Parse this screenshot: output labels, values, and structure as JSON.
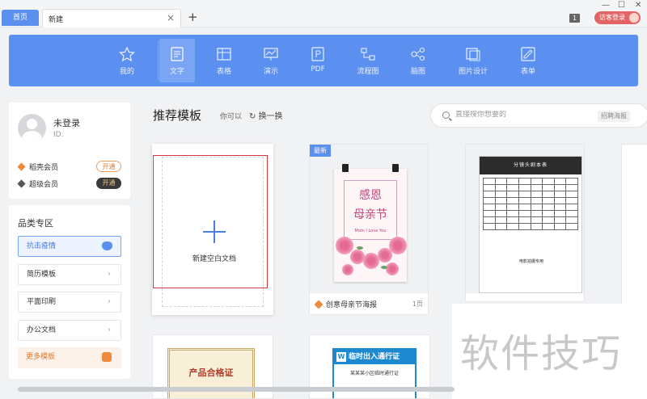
{
  "tabs": {
    "home": "首页",
    "new": "新建",
    "close": "×",
    "add": "+"
  },
  "window": {
    "badge": "1",
    "minimize": "—",
    "maximize": "☐",
    "close": "✕"
  },
  "account": {
    "guest_login": "访客登录"
  },
  "toolbar": {
    "items": [
      {
        "label": "我的",
        "icon": "star-icon"
      },
      {
        "label": "文字",
        "icon": "document-icon",
        "active": true
      },
      {
        "label": "表格",
        "icon": "table-icon"
      },
      {
        "label": "演示",
        "icon": "presentation-icon"
      },
      {
        "label": "PDF",
        "icon": "pdf-icon"
      },
      {
        "label": "流程图",
        "icon": "flowchart-icon"
      },
      {
        "label": "脑图",
        "icon": "mindmap-icon"
      },
      {
        "label": "图片设计",
        "icon": "image-design-icon"
      },
      {
        "label": "表单",
        "icon": "form-icon"
      }
    ]
  },
  "user": {
    "name": "未登录",
    "id_label": "ID:",
    "vip1": {
      "label": "稻壳会员",
      "button": "开通"
    },
    "vip2": {
      "label": "超级会员",
      "button": "开通"
    }
  },
  "categories": {
    "title": "品类专区",
    "items": [
      "抗击疫情",
      "简历模板",
      "平面印刷",
      "办公文档"
    ],
    "more": "更多模板"
  },
  "main": {
    "title": "推荐模板",
    "maybe": "你可以",
    "refresh": "换一换",
    "search_placeholder": "直接搜你想要的",
    "tags": [
      "招聘海报"
    ]
  },
  "cards": {
    "new_doc": "新建空白文档",
    "poster": {
      "badge": "最新",
      "title_line1": "感恩",
      "title_line2": "母亲节",
      "subtitle": "Mom I Love You",
      "name": "创意母亲节海报",
      "pages": "1页"
    },
    "script": {
      "header": "分镜头剧本表",
      "caption": "电影拍摄专用"
    },
    "cert": {
      "title": "产品合格证"
    },
    "pass": {
      "title": "临时出入通行证",
      "subtitle": "某某某小区临时通行证"
    }
  },
  "watermark": "软件技巧",
  "colors": {
    "accent": "#5b8ff0",
    "highlight": "#d7343c",
    "orange": "#e6782a"
  }
}
